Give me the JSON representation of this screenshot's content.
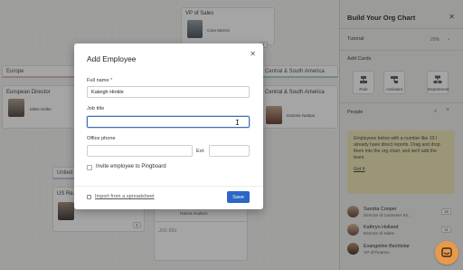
{
  "chart": {
    "vp": {
      "title": "VP of Sales",
      "name": "Cara Marvin",
      "count": "4"
    },
    "europe": {
      "header": "Europe",
      "title": "European Director",
      "name": "Miles Heller"
    },
    "csa": {
      "header": "Central & South America",
      "title": "Central & South America",
      "name": "Daniela Naleps"
    },
    "us": {
      "header": "United ...",
      "title": "US Re...",
      "count": "4"
    },
    "partial_name": "Hanna Hudson",
    "empty_title": "Job title"
  },
  "panel": {
    "title": "Build Your Org Chart",
    "tutorial_label": "Tutorial",
    "tutorial_progress": "20%",
    "add_cards_label": "Add Cards",
    "add_cards": [
      "Role",
      "Assistant",
      "Department"
    ],
    "people_label": "People",
    "tip_text": "Employees below with a number like 10 I already have direct reports. Drag and drop them into the org chart, and we'll add the team.",
    "tip_link": "Got It",
    "people": [
      {
        "name": "Sandra Cooper",
        "role": "Director of Customer Ex...",
        "count": "16"
      },
      {
        "name": "Kathryn Holland",
        "role": "Director of Sales",
        "count": "11"
      },
      {
        "name": "Evangeline Bechtolar",
        "role": "VP of Finance",
        "count": ""
      }
    ]
  },
  "modal": {
    "title": "Add Employee",
    "full_name_label": "Full name",
    "required_mark": "*",
    "full_name_value": "Kaleigh Hinkle",
    "job_title_label": "Job title",
    "job_title_value": "",
    "phone_label": "Office phone",
    "ext_label": "Ext.",
    "invite_label": "Invite employee to Pingboard",
    "import_label": "Import from a spreadsheet",
    "save_label": "Save"
  },
  "colors": {
    "accent": "#2a67c6",
    "tip_bg": "#efe5b3",
    "chat": "#e89a4a"
  }
}
